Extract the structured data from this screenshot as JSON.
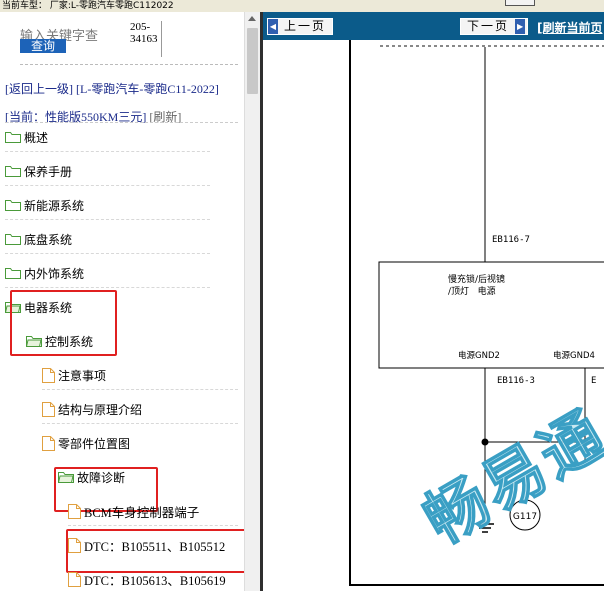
{
  "topbar": {
    "text": "当前车型： 厂家:L-零跑汽车零跑C112022"
  },
  "search": {
    "placeholder": "输入关键字查",
    "button": "查询",
    "code": "205-\n34163"
  },
  "nav": {
    "back_label": "[返回上一级]",
    "back_path": "[L-零跑汽车-零跑C11-2022]",
    "current_prefix": "[当前：",
    "current_value": "性能版550KM三元]",
    "refresh": "[刷新]"
  },
  "tree": {
    "items": [
      {
        "label": "概述",
        "icon": "folder-icon"
      },
      {
        "label": "保养手册",
        "icon": "folder-icon"
      },
      {
        "label": "新能源系统",
        "icon": "folder-icon"
      },
      {
        "label": "底盘系统",
        "icon": "folder-icon"
      },
      {
        "label": "内外饰系统",
        "icon": "folder-icon"
      },
      {
        "label": "电器系统",
        "icon": "folder-open-icon"
      },
      {
        "label": "控制系统",
        "icon": "folder-open-icon"
      },
      {
        "label": "注意事项",
        "icon": "document-icon"
      },
      {
        "label": "结构与原理介绍",
        "icon": "document-icon"
      },
      {
        "label": "零部件位置图",
        "icon": "document-icon"
      },
      {
        "label": "故障诊断",
        "icon": "folder-open-icon"
      },
      {
        "label": "BCM车身控制器端子",
        "icon": "document-icon"
      },
      {
        "label": "DTC：B105511、B105512",
        "icon": "document-icon"
      },
      {
        "label": "DTC：B105613、B105619",
        "icon": "document-icon"
      }
    ]
  },
  "viewer": {
    "prev_label": "上一页",
    "next_label": "下一页",
    "refresh_current": "[刷新当前页"
  },
  "diagram_text": {
    "connector_top": "EB116-7",
    "box_line1": "慢充锁/后视镜",
    "box_line2": "/顶灯   电源",
    "gnd2": "电源GND2",
    "gnd4": "电源GND4",
    "connector_bottom": "EB116-3",
    "connector_bottom2": "E",
    "ground": "G117",
    "watermark": "畅易通"
  },
  "colors": {
    "highlight": "#e02020",
    "navbar": "#0b5b8a",
    "link": "#1a2a8a",
    "search_button": "#1d63b8"
  }
}
